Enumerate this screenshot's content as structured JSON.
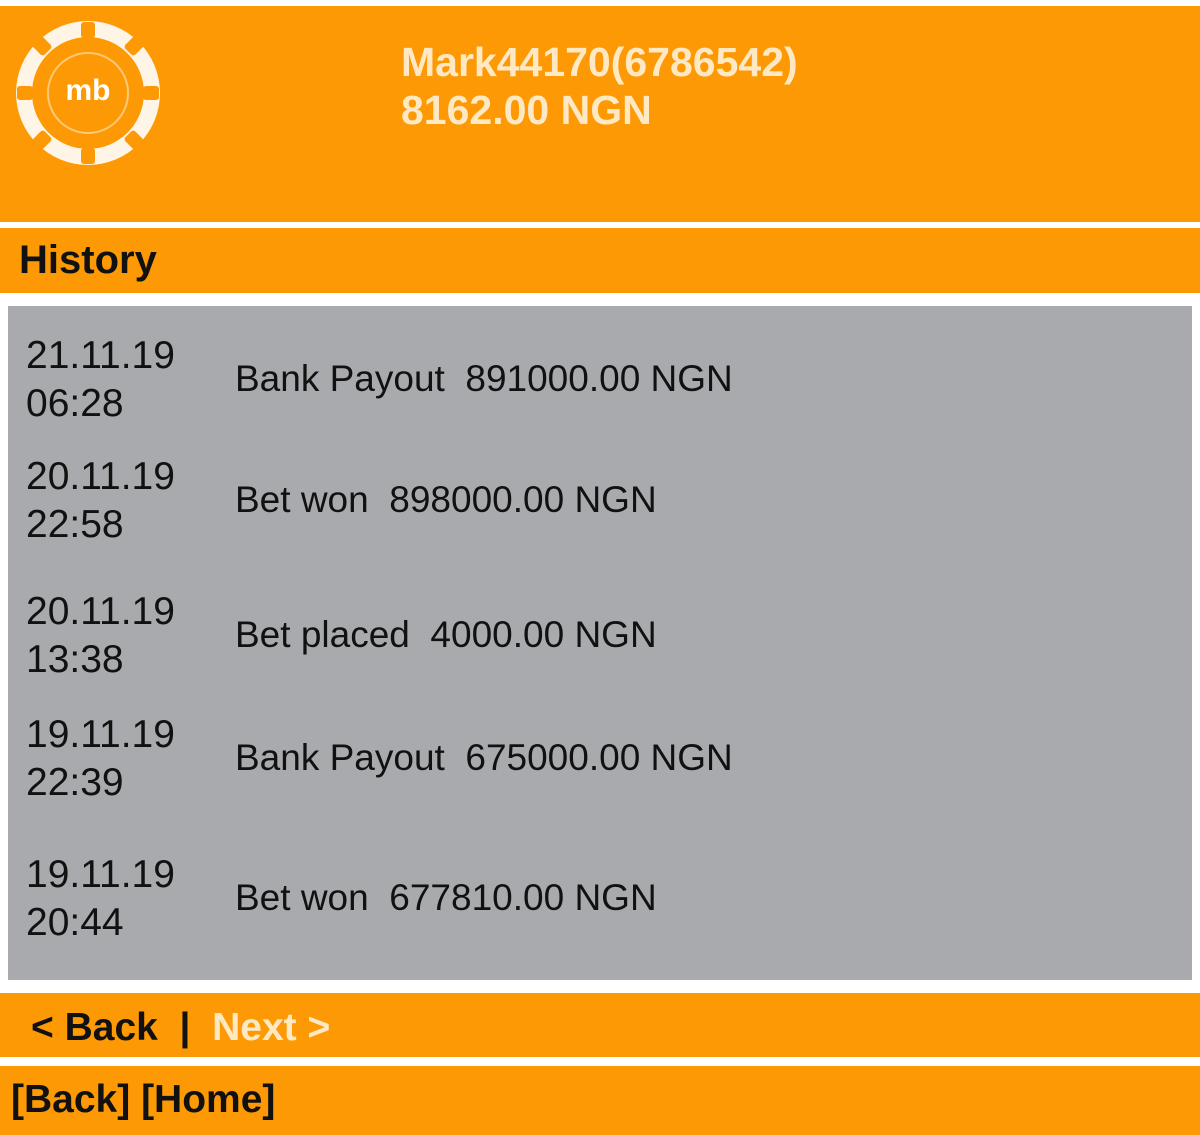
{
  "header": {
    "logo": {
      "icon": "mb-logo-icon",
      "text": "mb"
    },
    "user": "Mark44170(6786542)",
    "balance": "8162.00 NGN"
  },
  "section": {
    "title": "History"
  },
  "history": [
    {
      "date": "21.11.19",
      "time": "06:28",
      "type": "Bank Payout",
      "amount": "891000.00 NGN"
    },
    {
      "date": "20.11.19",
      "time": "22:58",
      "type": "Bet won",
      "amount": "898000.00 NGN"
    },
    {
      "date": "20.11.19",
      "time": "13:38",
      "type": "Bet placed",
      "amount": "4000.00 NGN"
    },
    {
      "date": "19.11.19",
      "time": "22:39",
      "type": "Bank Payout",
      "amount": "675000.00 NGN"
    },
    {
      "date": "19.11.19",
      "time": "20:44",
      "type": "Bet won",
      "amount": "677810.00 NGN"
    }
  ],
  "pager": {
    "back": "< Back",
    "separator": "|",
    "next": "Next >"
  },
  "footer": {
    "back": "[Back]",
    "home": "[Home]"
  },
  "colors": {
    "accent": "#fd9904",
    "panel": "#a9aaad",
    "highlight_text": "#ffe9c4"
  }
}
